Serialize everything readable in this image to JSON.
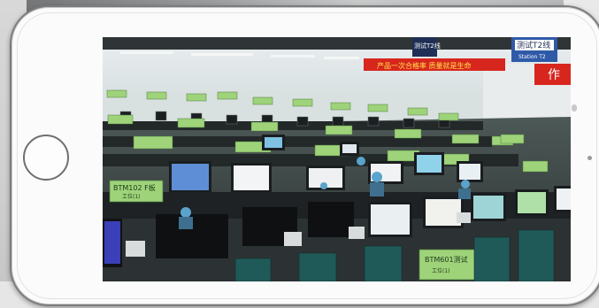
{
  "scene": {
    "description_label": "",
    "banners": {
      "top_sign_1": "测试T2线",
      "top_sign_2": "测试T2线",
      "top_sign_sub": "Station T2",
      "red_banner": "产品一次合格率 质量就是生命",
      "red_banner_right": "作"
    },
    "station_labels": [
      "BTM102 F板",
      "BTM601测试",
      "BTM101",
      "BTM102",
      "BTM103",
      "BTM104",
      "BTM105",
      "BTM106",
      "BTM107",
      "BTM108"
    ],
    "station_sublabels": [
      "工位(1)",
      "工位(1)"
    ]
  },
  "colors": {
    "phone_body": "#fbfbfb",
    "phone_border": "#7c7c7c",
    "label_green": "#9ed37a",
    "banner_red": "#d7261e",
    "sign_blue": "#2f5aa8"
  }
}
